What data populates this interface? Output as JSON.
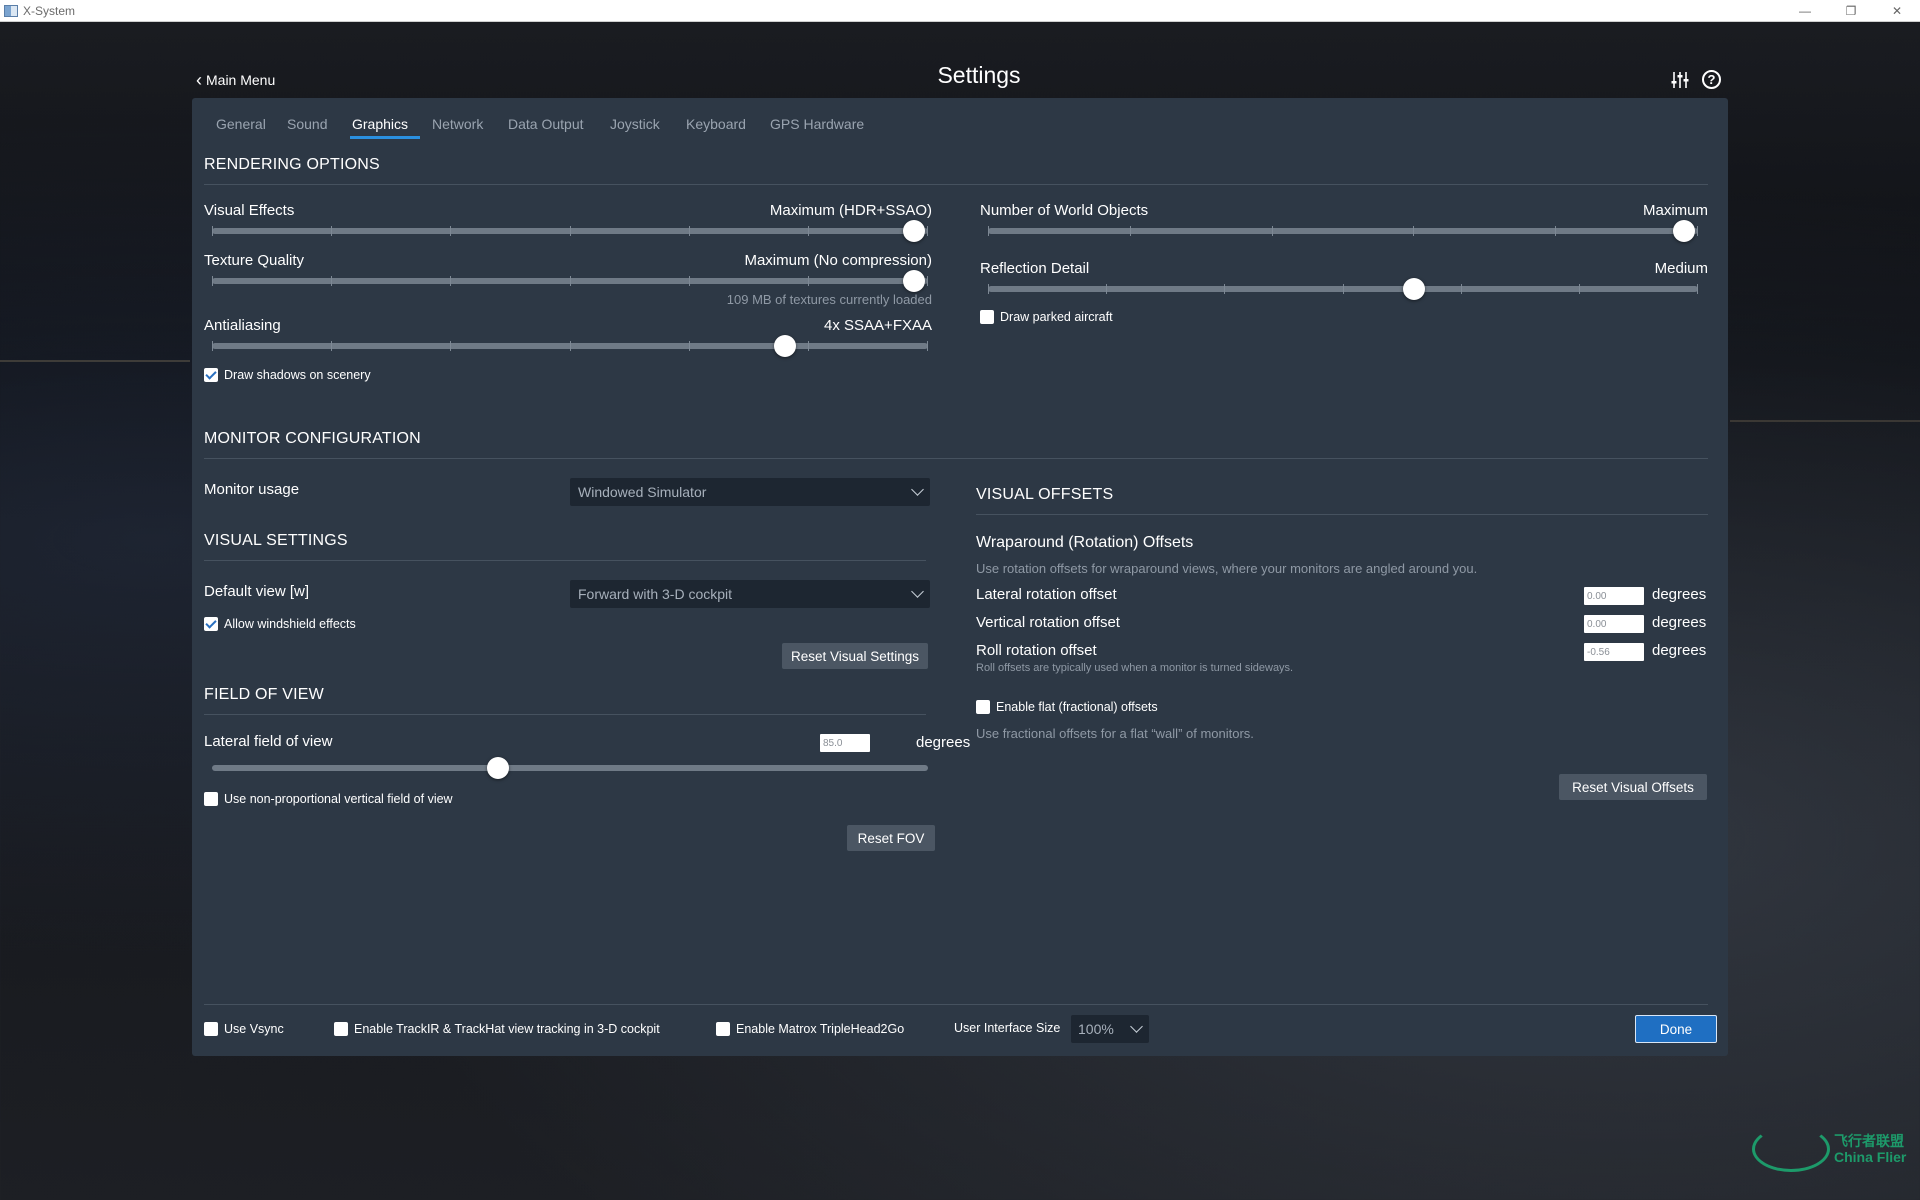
{
  "window": {
    "title": "X-System",
    "controls": [
      "—",
      "❐",
      "✕"
    ]
  },
  "header": {
    "back_label": "Main Menu",
    "title": "Settings"
  },
  "tabs": [
    {
      "label": "General"
    },
    {
      "label": "Sound"
    },
    {
      "label": "Graphics"
    },
    {
      "label": "Network"
    },
    {
      "label": "Data Output"
    },
    {
      "label": "Joystick"
    },
    {
      "label": "Keyboard"
    },
    {
      "label": "GPS Hardware"
    }
  ],
  "rendering": {
    "title": "RENDERING OPTIONS",
    "visual_effects": {
      "label": "Visual Effects",
      "value": "Maximum (HDR+SSAO)",
      "level": 1.0
    },
    "texture_quality": {
      "label": "Texture Quality",
      "value": "Maximum (No compression)",
      "level": 1.0,
      "note": "109 MB of textures currently loaded"
    },
    "antialiasing": {
      "label": "Antialiasing",
      "value": "4x SSAA+FXAA",
      "level": 0.8
    },
    "draw_shadows": {
      "label": "Draw shadows on scenery",
      "checked": true
    },
    "world_objects": {
      "label": "Number of World Objects",
      "value": "Maximum",
      "level": 1.0
    },
    "reflection_detail": {
      "label": "Reflection Detail",
      "value": "Medium",
      "level": 0.6
    },
    "draw_parked": {
      "label": "Draw parked aircraft",
      "checked": false
    }
  },
  "monitor": {
    "title": "MONITOR CONFIGURATION",
    "usage_label": "Monitor usage",
    "usage_value": "Windowed Simulator"
  },
  "visual_settings": {
    "title": "VISUAL SETTINGS",
    "default_view_label": "Default view [w]",
    "default_view_value": "Forward with 3-D cockpit",
    "windshield": {
      "label": "Allow windshield effects",
      "checked": true
    },
    "reset_label": "Reset Visual Settings"
  },
  "fov": {
    "title": "FIELD OF VIEW",
    "lateral_label": "Lateral field of view",
    "lateral_value": "85.0",
    "unit": "degrees",
    "level": 0.4,
    "nonprop": {
      "label": "Use non-proportional vertical field of view",
      "checked": false
    },
    "reset_label": "Reset FOV"
  },
  "offsets": {
    "title": "VISUAL OFFSETS",
    "wrap_title": "Wraparound (Rotation) Offsets",
    "wrap_hint": "Use rotation offsets for wraparound views, where your monitors are angled around you.",
    "lateral": {
      "label": "Lateral rotation offset",
      "value": "0.00"
    },
    "vertical": {
      "label": "Vertical rotation offset",
      "value": "0.00"
    },
    "roll": {
      "label": "Roll rotation offset",
      "value": "-0.56",
      "hint": "Roll offsets are typically used when a monitor is turned sideways."
    },
    "unit": "degrees",
    "flat": {
      "label": "Enable flat (fractional) offsets",
      "checked": false,
      "hint": "Use fractional offsets for a flat “wall” of monitors."
    },
    "reset_label": "Reset Visual Offsets"
  },
  "footer": {
    "vsync": {
      "label": "Use Vsync",
      "checked": false
    },
    "trackir": {
      "label": "Enable TrackIR & TrackHat view tracking in 3-D cockpit",
      "checked": false
    },
    "matrox": {
      "label": "Enable Matrox TripleHead2Go",
      "checked": false
    },
    "ui_size_label": "User Interface Size",
    "ui_size_value": "100%",
    "done_label": "Done"
  },
  "watermark": {
    "cn": "飞行者联盟",
    "en": "China Flier"
  },
  "colors": {
    "panel": "#2d3845",
    "accent": "#2a90e0",
    "done": "#1f6fc2"
  }
}
